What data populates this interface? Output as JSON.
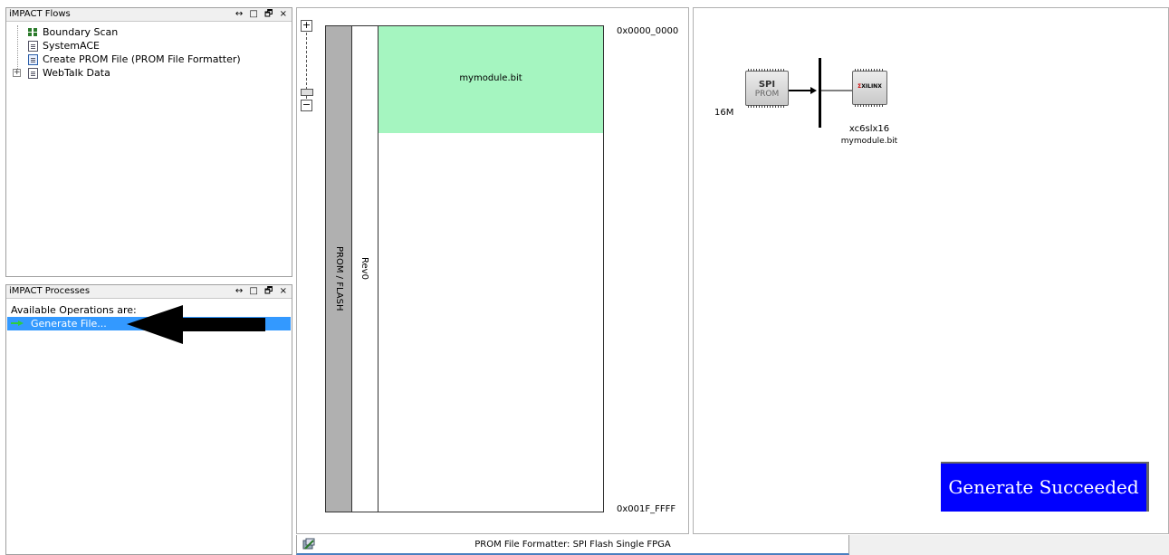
{
  "flows_panel": {
    "title": "iMPACT Flows",
    "items": [
      {
        "label": "Boundary Scan",
        "icon": "boundary-scan-icon"
      },
      {
        "label": "SystemACE",
        "icon": "document-icon"
      },
      {
        "label": "Create PROM File (PROM File Formatter)",
        "icon": "document-blue-icon"
      },
      {
        "label": "WebTalk Data",
        "icon": "document-icon",
        "expandable": true
      }
    ]
  },
  "processes_panel": {
    "title": "iMPACT Processes",
    "heading": "Available Operations are:",
    "operations": [
      {
        "label": "Generate File...",
        "selected": true
      }
    ]
  },
  "panel_controls": {
    "pin": "↔",
    "restore": "□",
    "float": "🗗",
    "close": "×"
  },
  "zoom": {
    "plus": "+",
    "minus": "−"
  },
  "prom_view": {
    "device_label": "PROM / FLASH",
    "revision_label": "Rev0",
    "bitstream_label": "mymodule.bit",
    "start_address": "0x0000_0000",
    "end_address": "0x001F_FFFF"
  },
  "chain_view": {
    "size_label": "16M",
    "prom_chip": {
      "line1": "SPI",
      "line2": "PROM"
    },
    "fpga_chip": {
      "logo": "XILINX",
      "device": "xc6slx16",
      "file": "mymodule.bit"
    }
  },
  "status": {
    "tab_label": "PROM File Formatter: SPI Flash Single FPGA"
  },
  "result_banner": {
    "text": "Generate Succeeded",
    "color": "#0000ff"
  },
  "colors": {
    "selection": "#3399ff",
    "bitstream_block": "#a5f5c0",
    "prom_bar": "#b0b0b0"
  }
}
